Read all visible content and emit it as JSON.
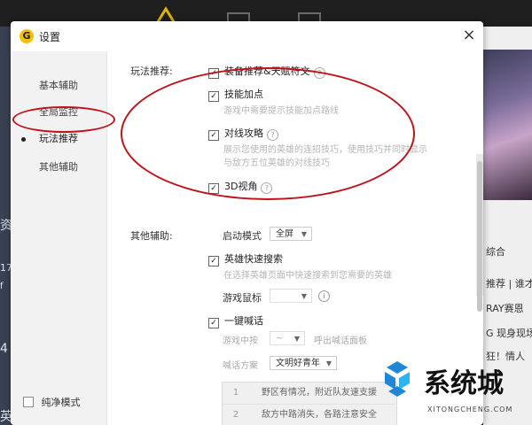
{
  "dialog": {
    "title": "设置",
    "close_glyph": "×",
    "logo_letter": "G"
  },
  "sidebar": {
    "items": [
      {
        "label": "基本辅助"
      },
      {
        "label": "全局监控"
      },
      {
        "label": "玩法推荐",
        "active": true
      },
      {
        "label": "其他辅助"
      }
    ],
    "pure_mode": {
      "label": "纯净模式",
      "checked": false
    }
  },
  "gameplay": {
    "section_label": "玩法推荐:",
    "items": [
      {
        "label": "装备推荐&天赋符文",
        "checked": true
      },
      {
        "label": "技能加点",
        "checked": true,
        "desc": "游戏中需要提示技能加点路线"
      },
      {
        "label": "对线攻略",
        "checked": true,
        "desc1": "展示您使用的英雄的连招技巧，使用技巧并同时显示",
        "desc2": "与敌方五位英雄的对线技巧"
      },
      {
        "label": "3D视角",
        "checked": true
      }
    ],
    "help_glyph": "?"
  },
  "other": {
    "section_label": "其他辅助:",
    "launch_mode": {
      "label": "启动模式",
      "value": "全屏"
    },
    "hero_search": {
      "label": "英雄快速搜索",
      "checked": true,
      "desc": "在选择英雄页面中快速搜索到您需要的英雄"
    },
    "mouse": {
      "label": "游戏鼠标",
      "value": ""
    },
    "shout": {
      "label": "一键喊话",
      "checked": true,
      "press_label": "游戏中按",
      "key_value": "~",
      "press_suffix": "呼出喊话面板",
      "plan_label": "喊话方案",
      "plan_value": "文明好青年"
    },
    "info_glyph": "i",
    "phrases": [
      {
        "num": "1",
        "text": "野区有情况，附近队友速支援"
      },
      {
        "num": "2",
        "text": "敌方中路消失，各路注意安全"
      }
    ]
  },
  "background": {
    "left_chars": [
      "资",
      "17",
      "f",
      "4",
      "英"
    ],
    "right_items": [
      "综合",
      "推荐 | 谁才是",
      "RAY赛恩",
      "G 现身现场",
      "狂！情人"
    ]
  },
  "watermark": {
    "title": "系统城",
    "subtitle": "XITONGCHENG.COM"
  },
  "colors": {
    "annotation": "#c0121b",
    "logo": "#f5c000",
    "watermark_blue": "#1e88d6"
  },
  "icons": {
    "checkbox_checked": "checkbox-checked-icon",
    "help": "help-icon",
    "close": "close-icon",
    "dropdown": "chevron-down-icon"
  }
}
